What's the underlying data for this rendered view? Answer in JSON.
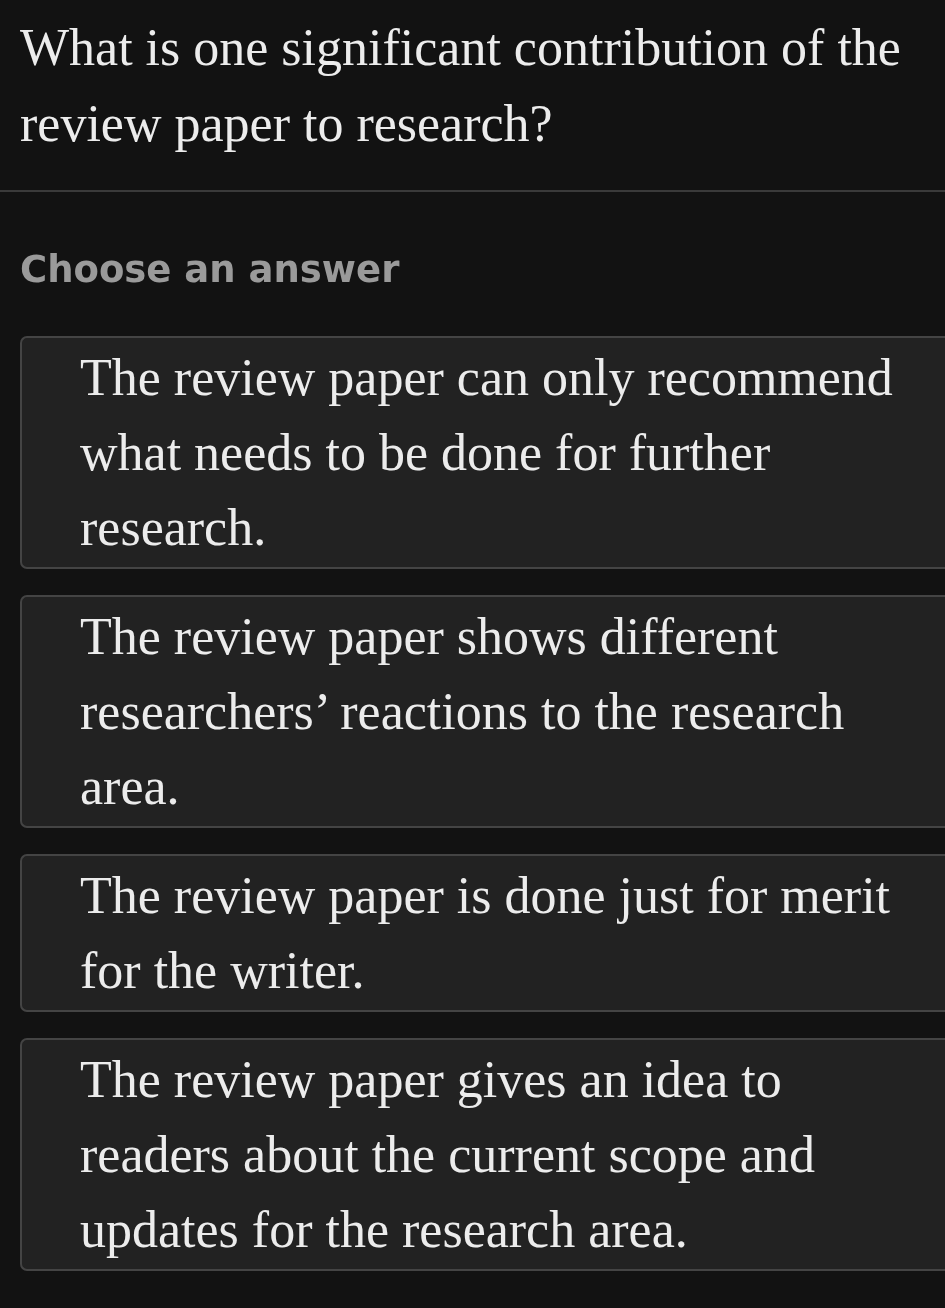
{
  "question": "What is one significant contribution of the review paper to research?",
  "prompt": "Choose an answer",
  "options": [
    {
      "label": "The review paper can only recommend what needs to be done for further research.",
      "selected": false
    },
    {
      "label": "The review paper shows different researchers’ reactions to the research area.",
      "selected": false
    },
    {
      "label": "The review paper is done just for merit for the writer.",
      "selected": false
    },
    {
      "label": "The review paper gives an idea to readers about the current scope and updates for the research area.",
      "selected": false
    }
  ]
}
